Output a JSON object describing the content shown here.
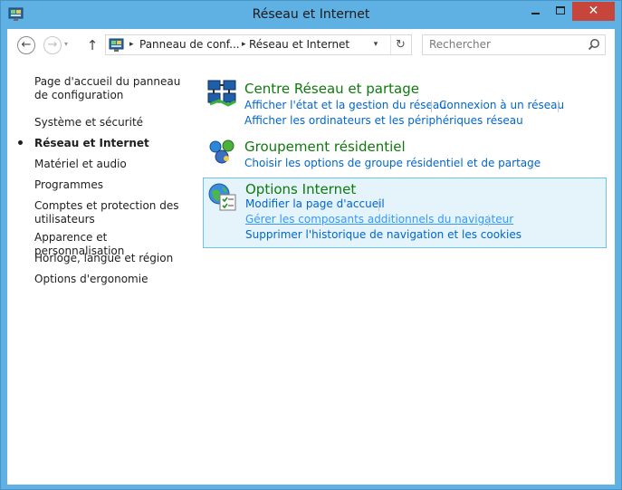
{
  "window": {
    "title": "Réseau et Internet",
    "close_glyph": "✕"
  },
  "nav": {
    "back_glyph": "←",
    "forward_glyph": "→",
    "recent_glyph": "▾",
    "up_glyph": "↑",
    "path_segments": [
      "Panneau de conf...",
      "Réseau et Internet"
    ],
    "separator_glyph": "▸",
    "dropdown_glyph": "▾",
    "refresh_glyph": "↻",
    "search_placeholder": "Rechercher"
  },
  "sidebar": {
    "items": [
      {
        "label": "Page d'accueil du panneau de configuration"
      },
      {
        "label": "Système et sécurité"
      },
      {
        "label": "Réseau et Internet",
        "current": true
      },
      {
        "label": "Matériel et audio"
      },
      {
        "label": "Programmes"
      },
      {
        "label": "Comptes et protection des utilisateurs"
      },
      {
        "label": "Apparence et personnalisation"
      },
      {
        "label": "Horloge, langue et région"
      },
      {
        "label": "Options d'ergonomie"
      }
    ]
  },
  "categories": [
    {
      "title": "Centre Réseau et partage",
      "icon": "network-center-icon",
      "links": [
        "Afficher l'état et la gestion du réseau",
        "Connexion à un réseau",
        "Afficher les ordinateurs et les périphériques réseau"
      ]
    },
    {
      "title": "Groupement résidentiel",
      "icon": "homegroup-icon",
      "links": [
        "Choisir les options de groupe résidentiel et de partage"
      ]
    },
    {
      "title": "Options Internet",
      "icon": "internet-options-icon",
      "links": [
        "Modifier la page d'accueil",
        "Gérer les composants additionnels du navigateur",
        "Supprimer l'historique de navigation et les cookies"
      ]
    }
  ],
  "colors": {
    "frame": "#5fb0e3",
    "close_button": "#c7463b",
    "category_title": "#0e7a0d",
    "link": "#0066cc",
    "link_hover": "#3399ff",
    "selection_bg": "#e5f3fb",
    "selection_border": "#70c0e7"
  }
}
